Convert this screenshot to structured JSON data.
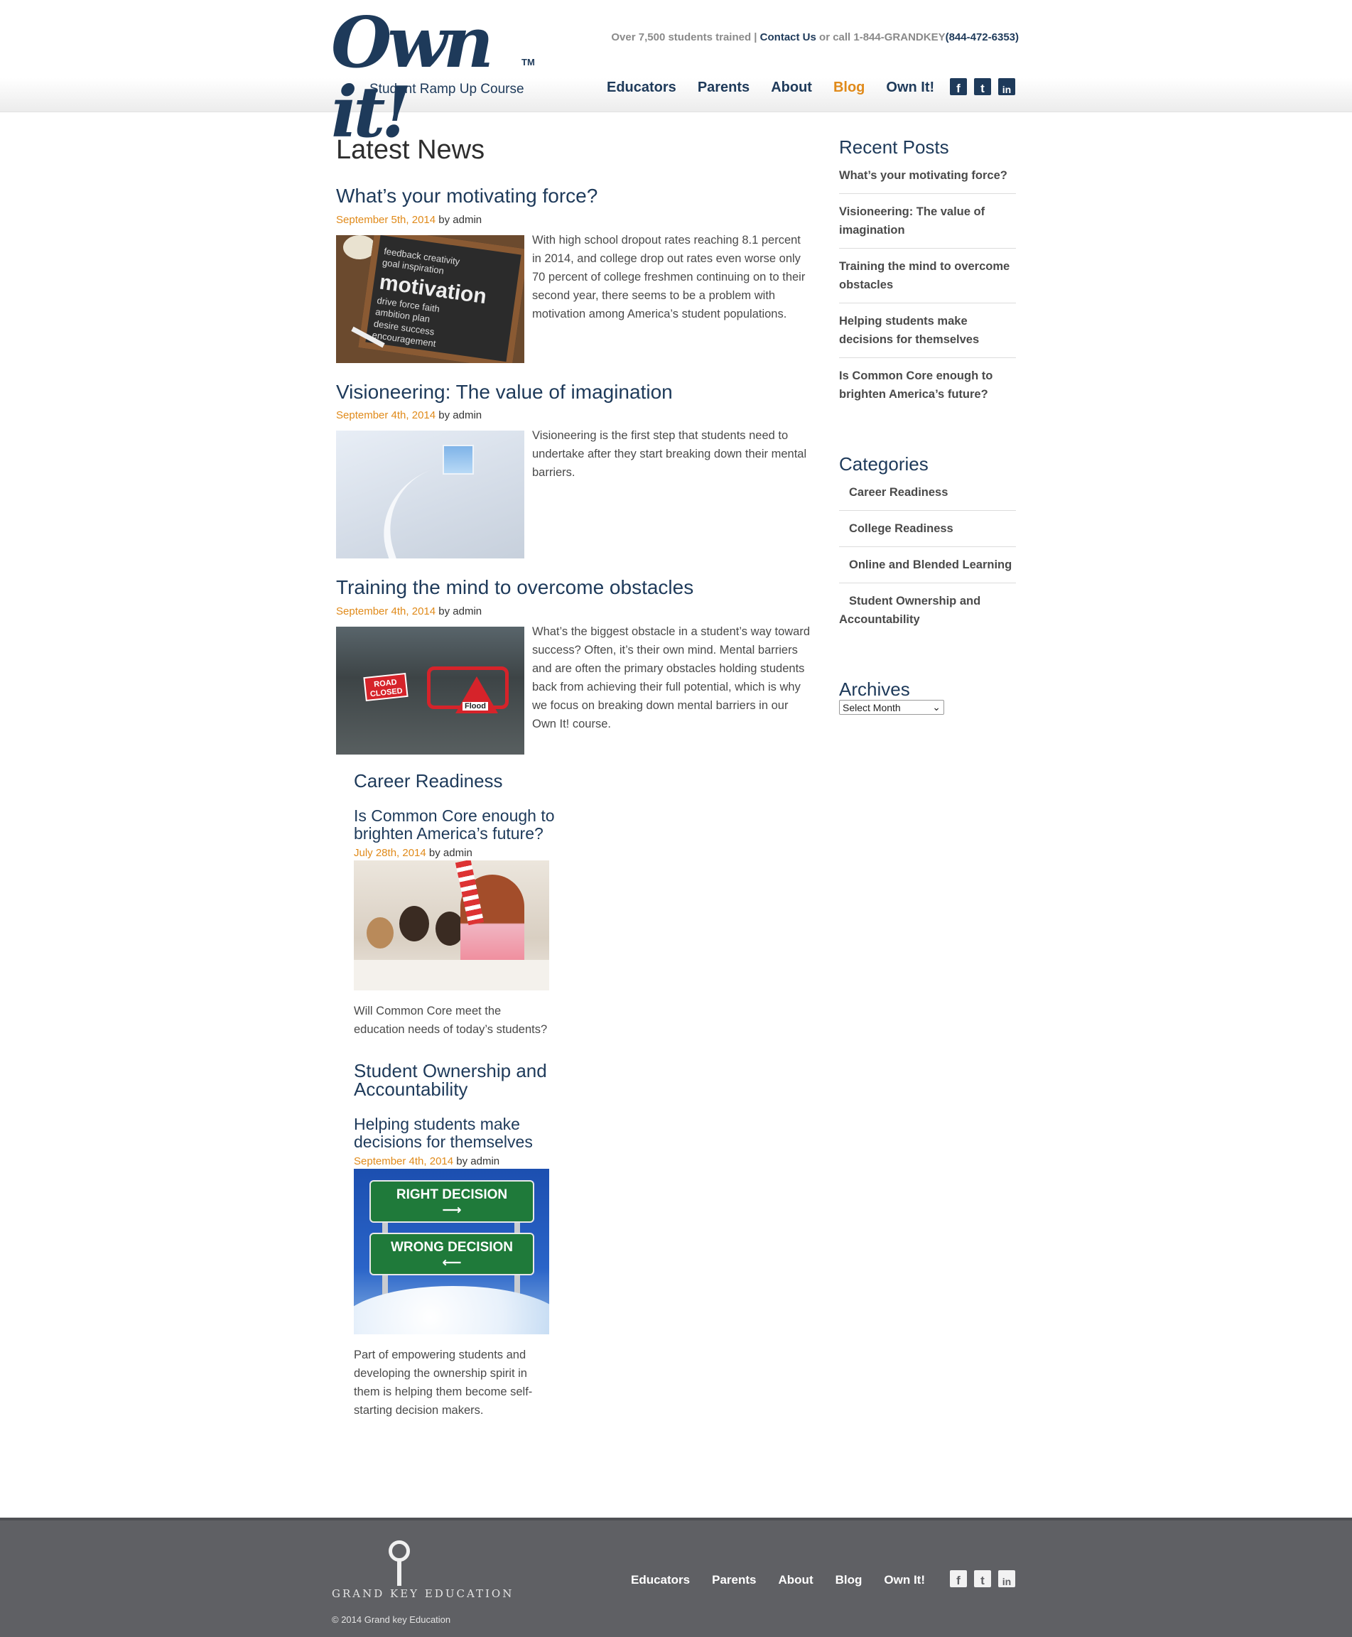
{
  "header": {
    "logo_text": "Own it!",
    "logo_tm": "TM",
    "tagline": "Student Ramp Up Course",
    "topline_prefix": "Over 7,500 students trained | ",
    "contact_link": "Contact Us",
    "topline_mid": " or call 1-844-GRANDKEY",
    "phone": "(844-472-6353)",
    "nav": [
      {
        "label": "Educators"
      },
      {
        "label": "Parents"
      },
      {
        "label": "About"
      },
      {
        "label": "Blog"
      },
      {
        "label": "Own It!"
      }
    ],
    "active_nav": "Blog",
    "social": [
      {
        "icon": "facebook-icon",
        "glyph": "f"
      },
      {
        "icon": "twitter-icon",
        "glyph": "t"
      },
      {
        "icon": "linkedin-icon",
        "glyph": "in"
      }
    ]
  },
  "main": {
    "title": "Latest News",
    "posts": [
      {
        "title": "What’s your motivating force?",
        "date": "September 5th, 2014",
        "by": " by admin",
        "excerpt": "With high school dropout rates reaching 8.1 percent in 2014, and college drop out rates even worse only 70 percent of college freshmen continuing on to their second year, there seems to be a problem with motivation among America’s student populations.",
        "thumb_words": [
          "feedback creativity",
          "goal inspiration",
          "motivation",
          "drive force faith",
          "ambition plan",
          "desire success",
          "encouragement"
        ],
        "thumb_big": "motivation"
      },
      {
        "title": "Visioneering: The value of imagination",
        "date": "September 4th, 2014",
        "by": " by admin",
        "excerpt": "Visioneering is the first step that students need to undertake after they start breaking down their mental barriers."
      },
      {
        "title": "Training the mind to overcome obstacles",
        "date": "September 4th, 2014",
        "by": " by admin",
        "excerpt": "What’s the biggest obstacle in a student’s way toward success? Often, it’s their own mind. Mental barriers and are often the primary obstacles holding students back from achieving their full potential, which is why we focus on breaking down mental barriers in our Own It! course.",
        "sign_text": "ROAD CLOSED",
        "flood_text": "Flood"
      }
    ],
    "category_sections": [
      {
        "category": "Career Readiness",
        "post_title": "Is Common Core enough to brighten America’s future?",
        "date": "July 28th, 2014",
        "by": " by admin",
        "excerpt": "Will Common Core meet the education needs of today’s students?"
      },
      {
        "category": "Student Ownership and Accountability",
        "post_title": "Helping students make decisions for themselves",
        "date": "September 4th, 2014",
        "by": " by admin",
        "excerpt": "Part of empowering students and developing the ownership spirit in them is helping them become self-starting decision makers.",
        "sign_right": "RIGHT DECISION",
        "sign_wrong": "WRONG DECISION"
      }
    ]
  },
  "sidebar": {
    "recent_title": "Recent Posts",
    "recent": [
      "What’s your motivating force?",
      "Visioneering: The value of imagination",
      "Training the mind to overcome obstacles",
      "Helping students make decisions for themselves",
      "Is Common Core enough to brighten America’s future?"
    ],
    "categories_title": "Categories",
    "categories": [
      "Career Readiness",
      "College Readiness",
      "Online and Blended Learning",
      "Student Ownership and Accountability"
    ],
    "archives_title": "Archives",
    "archives_select": "Select Month"
  },
  "footer": {
    "brand": "GRAND KEY EDUCATION",
    "copyright": "© 2014 Grand key Education",
    "nav": [
      "Educators",
      "Parents",
      "About",
      "Blog",
      "Own It!"
    ]
  },
  "colors": {
    "brand_navy": "#1e3a5a",
    "accent_orange": "#e08a1a",
    "footer_gray": "#5f6064"
  }
}
